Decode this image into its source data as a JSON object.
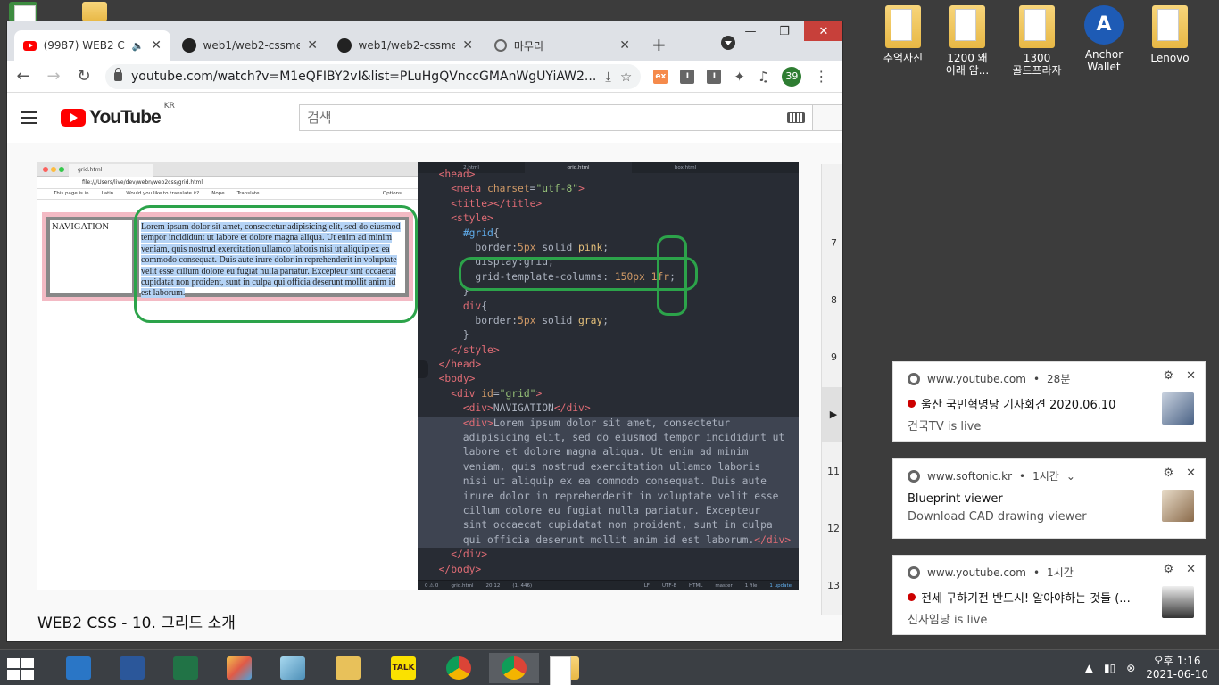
{
  "desktop": {
    "icons": [
      {
        "label": "추억사진"
      },
      {
        "label": "1200 왜\n이래 암..."
      },
      {
        "label": "1300\n골드프라자"
      },
      {
        "label": "Anchor\nWallet"
      },
      {
        "label": "Lenovo"
      }
    ]
  },
  "browser": {
    "tabs": [
      {
        "title": "(9987) WEB2 CSS",
        "icon": "youtube-icon",
        "active": true
      },
      {
        "title": "web1/web2-cssmenu",
        "icon": "github-icon"
      },
      {
        "title": "web1/web2-cssmenu",
        "icon": "github-icon"
      },
      {
        "title": "마무리",
        "icon": "globe-icon"
      }
    ],
    "url": "youtube.com/watch?v=M1eQFIBY2vI&list=PLuHgQVnccGMAnWgUYiAW2...",
    "profile_badge": "39"
  },
  "youtube": {
    "logo_text": "YouTube",
    "region": "KR",
    "search_placeholder": "검색",
    "video_title": "WEB2 CSS - 10. 그리드 소개",
    "side_numbers": [
      "7",
      "8",
      "9",
      "11",
      "12",
      "13"
    ]
  },
  "video": {
    "inner_tab": "grid.html",
    "inner_url": "file:///Users/live/dev/webn/web2css/grid.html",
    "translate_bar": [
      "This page is in",
      "Latin",
      "Would you like to translate it?",
      "Nope",
      "Translate",
      "Options"
    ],
    "nav_text": "NAVIGATION",
    "lorem": "Lorem ipsum dolor sit amet, consectetur adipisicing elit, sed do eiusmod tempor incididunt ut labore et dolore magna aliqua. Ut enim ad minim veniam, quis nostrud exercitation ullamco laboris nisi ut aliquip ex ea commodo consequat. Duis aute irure dolor in reprehenderit in voluptate velit esse cillum dolore eu fugiat nulla pariatur. Excepteur sint occaecat cupidatat non proident, sunt in culpa qui officia deserunt mollit anim id est laborum.",
    "editor_tabs": [
      "2.html",
      "grid.html",
      "box.html"
    ],
    "editor_status": [
      "0 ⚠ 0",
      "grid.html",
      "20:12",
      "(1, 446)",
      "LF",
      "UTF-8",
      "HTML",
      "master",
      "1 file",
      "1 update"
    ]
  },
  "notifications": [
    {
      "source": "www.youtube.com",
      "time": "28분",
      "title": "울산 국민혁명당 기자회견 2020.06.10",
      "sub": "건국TV is live",
      "live": true
    },
    {
      "source": "www.softonic.kr",
      "time": "1시간",
      "title": "Blueprint viewer",
      "sub": "Download CAD drawing viewer",
      "live": false
    },
    {
      "source": "www.youtube.com",
      "time": "1시간",
      "title": "전세 구하기전 반드시! 알아야하는 것들 (...",
      "sub": "신사임당 is live",
      "live": true
    }
  ],
  "taskbar": {
    "time": "오후 1:16",
    "date": "2021-06-10"
  }
}
